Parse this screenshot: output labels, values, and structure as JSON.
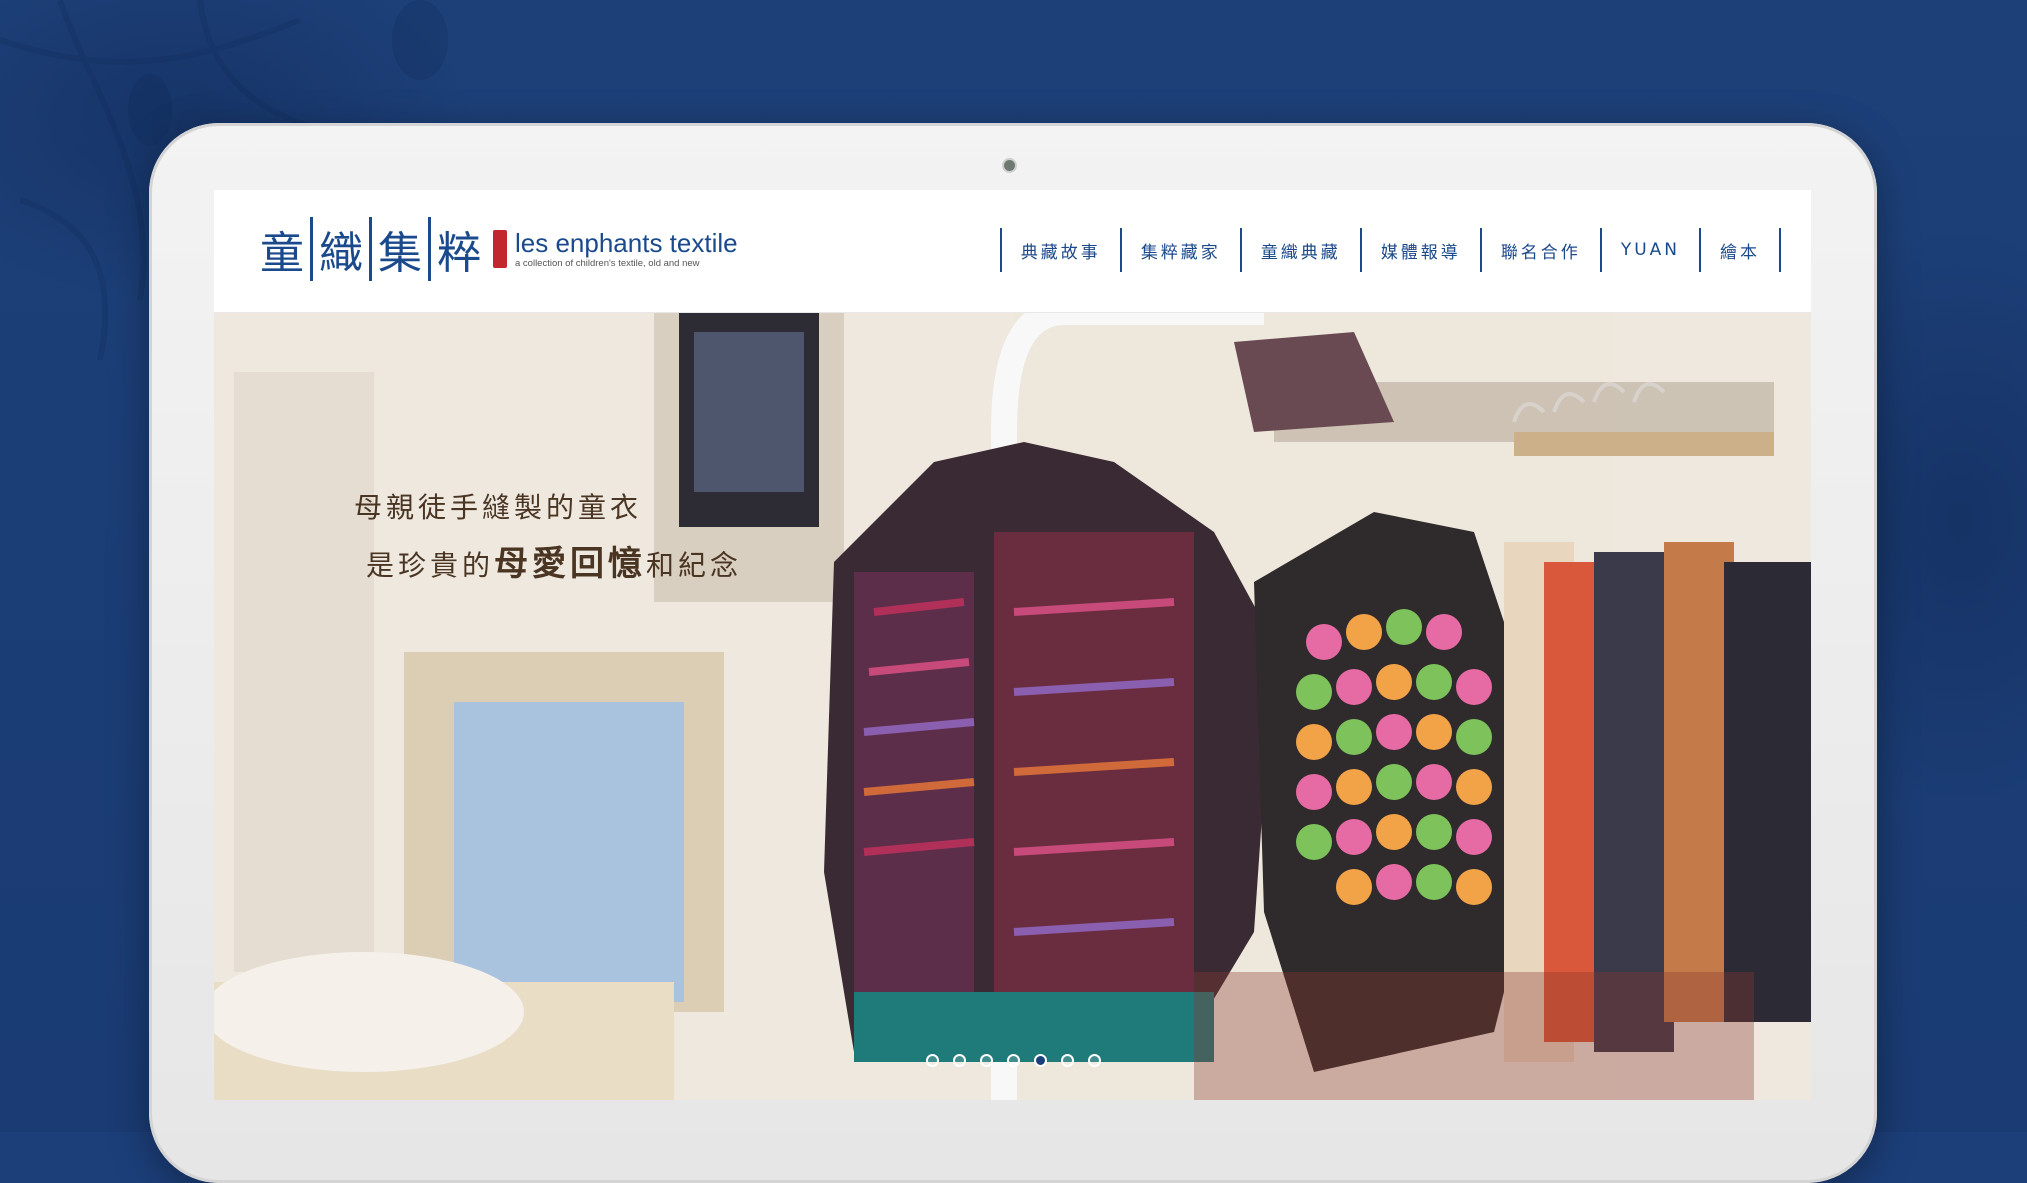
{
  "brand": {
    "logo_chars": [
      "童",
      "織",
      "集",
      "粹"
    ],
    "name_en": "les enphants textile",
    "tagline": "a collection of children's textile, old and new",
    "color": "#1b4a8c",
    "seal_color": "#c1272d"
  },
  "nav": {
    "items": [
      {
        "label": "典藏故事"
      },
      {
        "label": "集粹藏家"
      },
      {
        "label": "童織典藏"
      },
      {
        "label": "媒體報導"
      },
      {
        "label": "聯名合作"
      },
      {
        "label": "YUAN"
      },
      {
        "label": "繪本"
      }
    ]
  },
  "hero": {
    "line1": "母親徒手縫製的童衣",
    "line2_prefix": "是珍貴的",
    "line2_emphasis": "母愛回憶",
    "line2_suffix": "和紀念",
    "slides_total": 7,
    "active_slide": 5
  },
  "colors": {
    "page_background": "#1c3f7a",
    "active_dot": "#1b3f7c"
  }
}
